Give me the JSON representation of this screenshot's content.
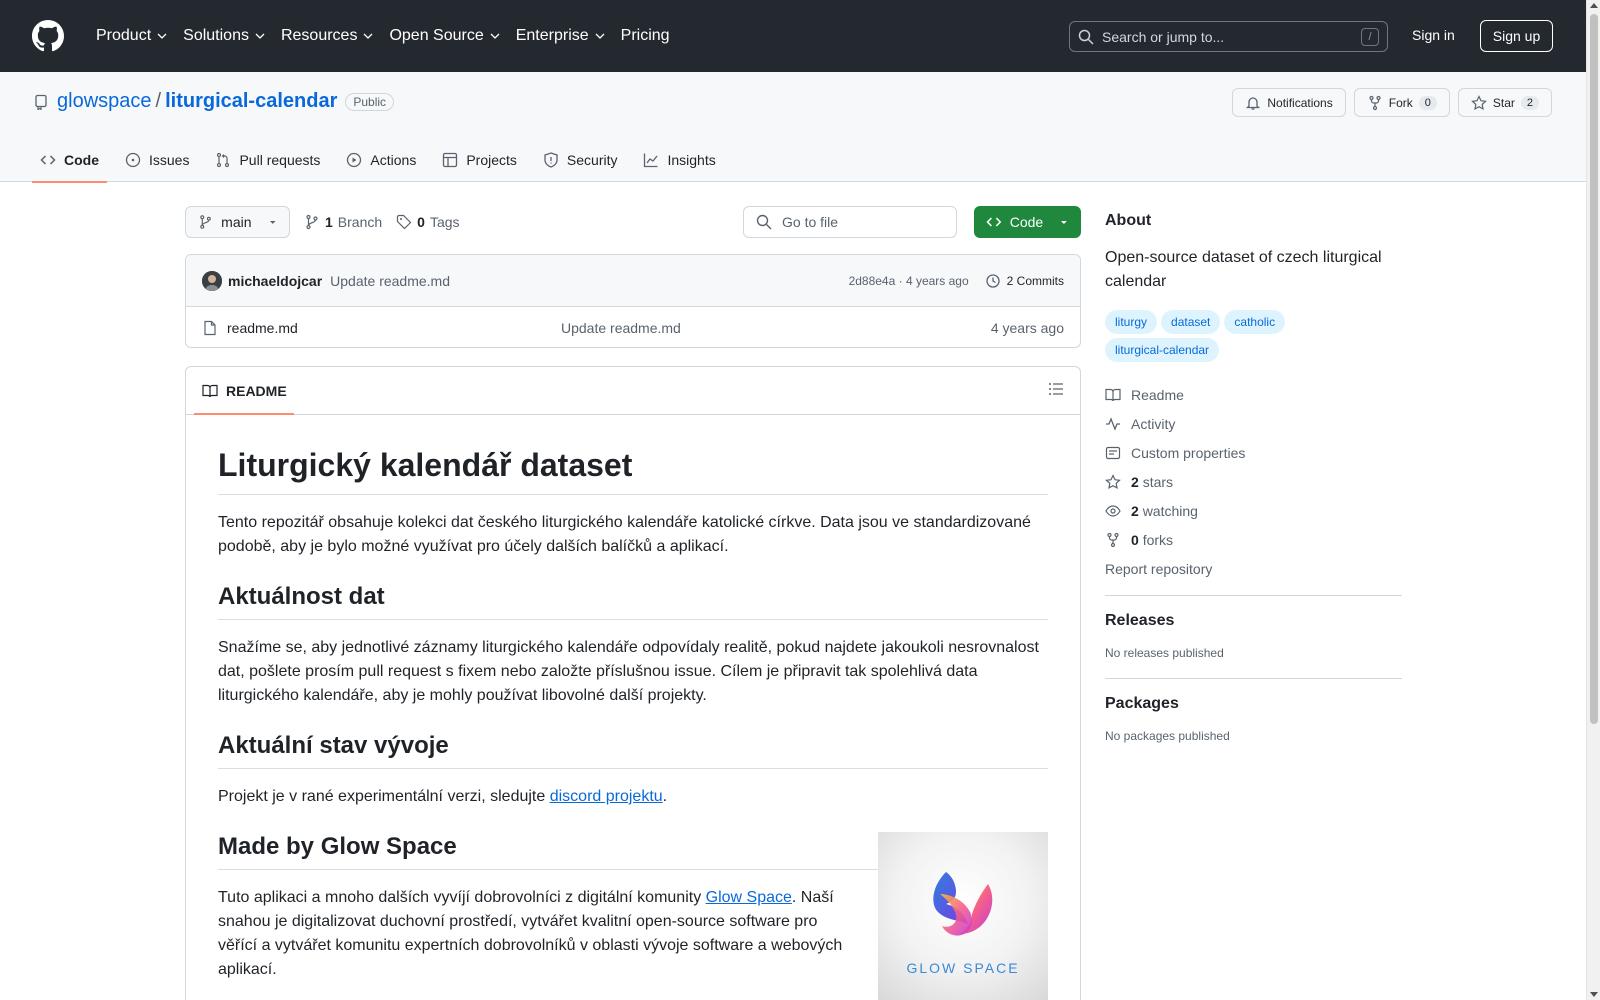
{
  "header": {
    "nav": [
      "Product",
      "Solutions",
      "Resources",
      "Open Source",
      "Enterprise",
      "Pricing"
    ],
    "search_placeholder": "Search or jump to...",
    "search_shortcut": "/",
    "sign_in": "Sign in",
    "sign_up": "Sign up"
  },
  "repo": {
    "owner": "glowspace",
    "separator": "/",
    "name": "liturgical-calendar",
    "visibility": "Public",
    "actions": {
      "notifications": "Notifications",
      "fork": "Fork",
      "fork_count": "0",
      "star": "Star",
      "star_count": "2"
    },
    "tabs": [
      "Code",
      "Issues",
      "Pull requests",
      "Actions",
      "Projects",
      "Security",
      "Insights"
    ]
  },
  "toolbar": {
    "branch": "main",
    "branch_count": "1",
    "branch_label": "Branch",
    "tag_count": "0",
    "tag_label": "Tags",
    "goto_placeholder": "Go to file",
    "code_button": "Code"
  },
  "commit": {
    "author": "michaeldojcar",
    "message": "Update readme.md",
    "hash_time": "2d88e4a · 4 years ago",
    "commits": "2 Commits"
  },
  "files": [
    {
      "name": "readme.md",
      "message": "Update readme.md",
      "age": "4 years ago"
    }
  ],
  "readme": {
    "tab": "README",
    "h1": "Liturgický kalendář dataset",
    "p1": "Tento repozitář obsahuje kolekci dat českého liturgického kalendáře katolické církve. Data jsou ve standardizované podobě, aby je bylo možné využívat pro účely dalších balíčků a aplikací.",
    "h2_1": "Aktuálnost dat",
    "p2": "Snažíme se, aby jednotlivé záznamy liturgického kalendáře odpovídaly realitě, pokud najdete jakoukoli nesrovnalost dat, pošlete prosím pull request s fixem nebo založte příslušnou issue. Cílem je připravit tak spolehlivá data liturgického kalendáře, aby je mohly používat libovolné další projekty.",
    "h2_2": "Aktuální stav vývoje",
    "p3_before": "Projekt je v rané experimentální verzi, sledujte ",
    "p3_link": "discord projektu",
    "p3_after": ".",
    "h2_3": "Made by Glow Space",
    "p4_before": "Tuto aplikaci a mnoho dalších vyvíjí dobrovolníci z digitální komunity ",
    "p4_link": "Glow Space",
    "p4_after": ". Naší snahou je digitalizovat duchovní prostředí, vytvářet kvalitní open-source software pro věřící a vytvářet komunitu expertních dobrovolníků v oblasti vývoje software a webových aplikací.",
    "logo_text": "GLOW SPACE"
  },
  "about": {
    "title": "About",
    "description": "Open-source dataset of czech liturgical calendar",
    "topics": [
      "liturgy",
      "dataset",
      "catholic",
      "liturgical-calendar"
    ],
    "readme": "Readme",
    "activity": "Activity",
    "custom_properties": "Custom properties",
    "stars_count": "2",
    "stars_label": "stars",
    "watching_count": "2",
    "watching_label": "watching",
    "forks_count": "0",
    "forks_label": "forks",
    "report": "Report repository"
  },
  "releases": {
    "title": "Releases",
    "empty": "No releases published"
  },
  "packages": {
    "title": "Packages",
    "empty": "No packages published"
  }
}
